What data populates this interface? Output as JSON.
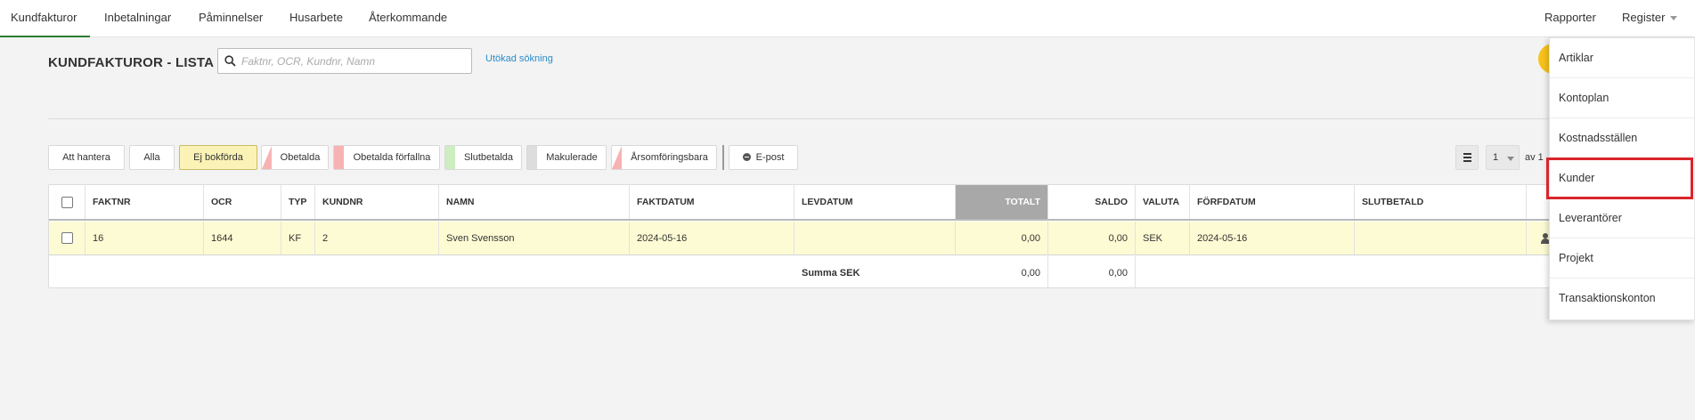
{
  "nav": {
    "tabs": [
      "Kundfakturor",
      "Inbetalningar",
      "Påminnelser",
      "Husarbete",
      "Återkommande"
    ],
    "rapporter": "Rapporter",
    "register": "Register"
  },
  "header": {
    "title": "KUNDFAKTUROR - LISTA",
    "search_placeholder": "Faktnr, OCR, Kundnr, Namn",
    "advanced_search": "Utökad sökning"
  },
  "filters": {
    "att_hantera": "Att hantera",
    "alla": "Alla",
    "ej_bokforda": "Ej bokförda",
    "obetalda": "Obetalda",
    "obetalda_forfallna": "Obetalda förfallna",
    "slutbetalda": "Slutbetalda",
    "makulerade": "Makulerade",
    "arsomforingsbara": "Årsomföringsbara",
    "epost": "E-post",
    "marker_colors": {
      "obetalda": "#f7b3b3",
      "obetalda_forfallna": "#f7b3b3",
      "slutbetalda": "#cdeec0",
      "makulerade": "#dddddd",
      "arsomforingsbara": "#f7b3b3"
    }
  },
  "pagination": {
    "page": "1",
    "of": "av 1"
  },
  "table": {
    "columns": {
      "faktnr": "FAKTNR",
      "ocr": "OCR",
      "typ": "TYP",
      "kundnr": "KUNDNR",
      "namn": "NAMN",
      "faktdatum": "FAKTDATUM",
      "levdatum": "LEVDATUM",
      "totalt": "TOTALT",
      "saldo": "SALDO",
      "valuta": "VALUTA",
      "forfdatum": "FÖRFDATUM",
      "slutbetald": "SLUTBETALD"
    },
    "rows": [
      {
        "faktnr": "16",
        "ocr": "1644",
        "typ": "KF",
        "kundnr": "2",
        "namn": "Sven Svensson",
        "faktdatum": "2024-05-16",
        "levdatum": "",
        "totalt": "0,00",
        "saldo": "0,00",
        "valuta": "SEK",
        "forfdatum": "2024-05-16",
        "slutbetald": ""
      }
    ],
    "sum": {
      "label": "Summa SEK",
      "totalt": "0,00",
      "saldo": "0,00"
    }
  },
  "register_menu": {
    "items": [
      "Artiklar",
      "Kontoplan",
      "Kostnadsställen",
      "Kunder",
      "Leverantörer",
      "Projekt",
      "Transaktionskonton"
    ],
    "highlighted": "Kunder"
  },
  "colors": {
    "active_tab": "#2e7d32",
    "link": "#2a8bc9",
    "selected_row": "#fdfbd3",
    "active_filter": "#fbf3b5",
    "highlight_box": "#d9252b"
  }
}
